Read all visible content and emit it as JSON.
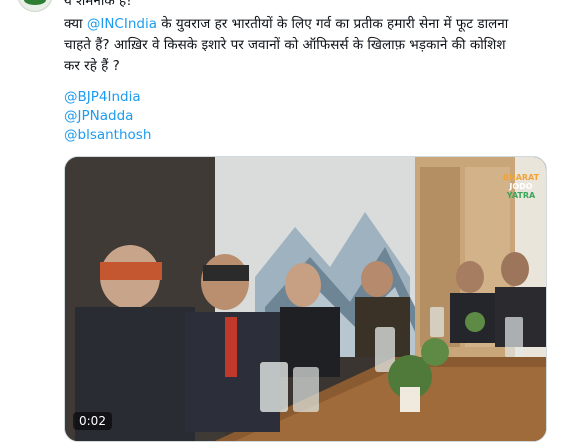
{
  "tweet": {
    "line0": "ये शर्मनाक है!",
    "line1_prefix": "क्या ",
    "line1_mention": "@INCIndia",
    "line1_suffix": " के युवराज हर भारतीयों के लिए गर्व का प्रतीक हमारी सेना में फूट डालना",
    "line2": "चाहते हैं? आख़िर वे किसके इशारे पर  जवानों को ऑफिसर्स के खिलाफ़ भड़काने की कोशिश",
    "line3": "कर रहे हैं ?",
    "tags": [
      "@BJP4India",
      "@JPNadda",
      "@blsanthosh"
    ]
  },
  "video": {
    "timestamp": "0:02",
    "watermark_line1": "BHARAT",
    "watermark_line2": "JODO",
    "watermark_line3": "YATRA"
  },
  "colors": {
    "link": "#1d9bf0",
    "text": "#0f1419",
    "border": "#cfd9de"
  }
}
